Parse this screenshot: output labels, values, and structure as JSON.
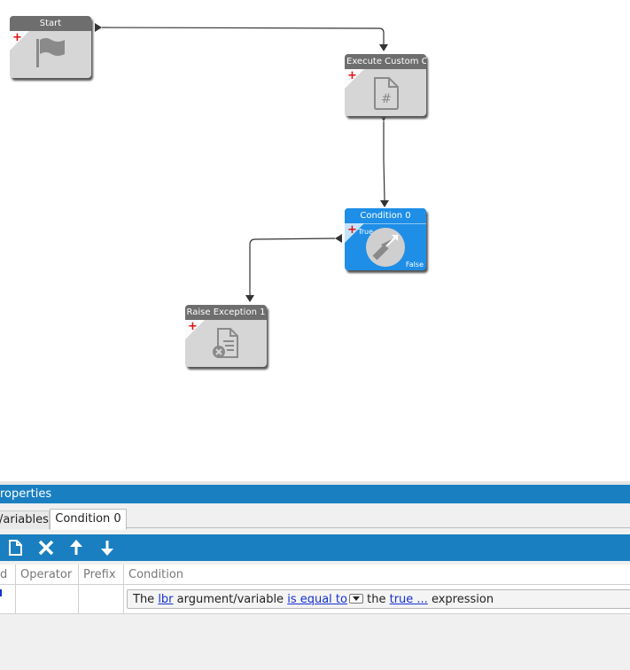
{
  "canvas": {
    "nodes": [
      {
        "title": "Start",
        "icon": "flag-icon"
      },
      {
        "title": "Execute Custom Cc",
        "icon": "script-file-icon"
      },
      {
        "title": "Condition 0",
        "icon": "condition-arrows-icon",
        "true_label": "True",
        "false_label": "False",
        "color": "#1e8ee6"
      },
      {
        "title": "Raise Exception 1",
        "icon": "exception-file-icon"
      }
    ]
  },
  "panel": {
    "title": "roperties",
    "tabs": [
      {
        "label": "/ariables"
      },
      {
        "label": "Condition 0"
      }
    ],
    "toolbar": {
      "buttons": [
        {
          "icon": "new-document-icon"
        },
        {
          "icon": "delete-x-icon"
        },
        {
          "icon": "arrow-up-icon"
        },
        {
          "icon": "arrow-down-icon"
        }
      ]
    },
    "grid": {
      "columns": [
        "d",
        "Operator",
        "Prefix",
        "Condition"
      ],
      "row": {
        "and_value": "",
        "operator": "",
        "prefix": "",
        "condition": {
          "part1": "The ",
          "argument": "lbr",
          "part2": " argument/variable ",
          "operator": "is equal to",
          "part3": " the ",
          "value": " true ...",
          "part4": " expression"
        }
      }
    }
  }
}
